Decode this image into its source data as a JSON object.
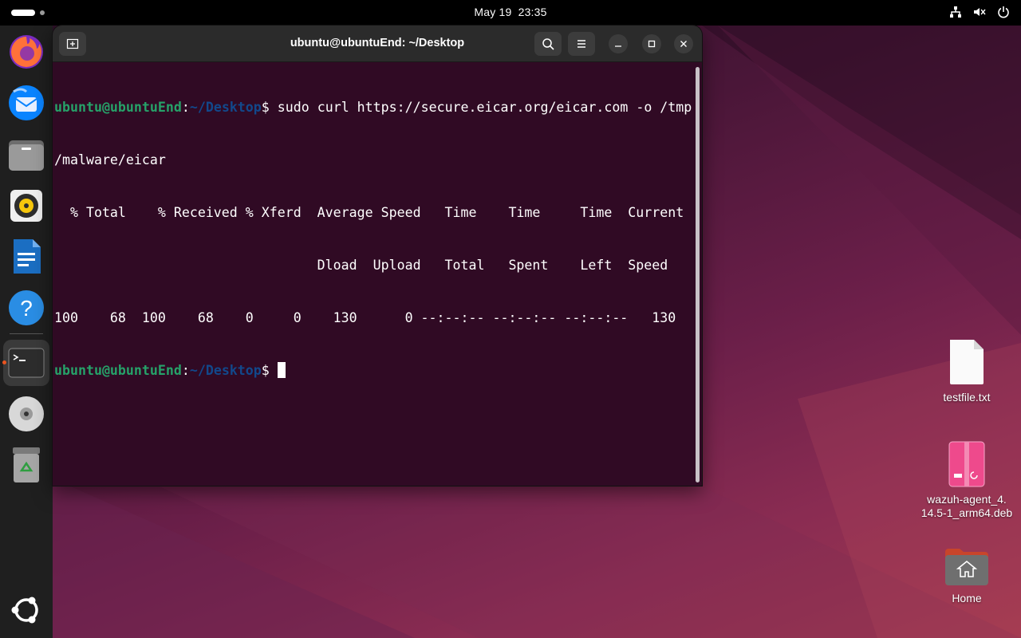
{
  "topbar": {
    "date": "May 19",
    "time": "23:35",
    "tray_icons": [
      "network-icon",
      "volume-muted-icon",
      "power-icon"
    ]
  },
  "dock": {
    "items": [
      "firefox",
      "thunderbird",
      "files",
      "rhythmbox",
      "libreoffice-writer",
      "help",
      "terminal",
      "optical-drive",
      "trash",
      "show-apps"
    ],
    "active": "terminal"
  },
  "terminal": {
    "title": "ubuntu@ubuntuEnd: ~/Desktop",
    "prompt_user": "ubuntu@ubuntuEnd",
    "prompt_sep": ":",
    "prompt_path": "~/Desktop",
    "prompt_sym": "$",
    "command": " sudo curl https://secure.eicar.org/eicar.com -o /tmp",
    "command_cont": "/malware/eicar",
    "output": [
      "  % Total    % Received % Xferd  Average Speed   Time    Time     Time  Current",
      "                                 Dload  Upload   Total   Spent    Left  Speed",
      "100    68  100    68    0     0    130      0 --:--:-- --:--:-- --:--:--   130"
    ]
  },
  "desktop": {
    "icons": [
      {
        "label": "testfile.txt"
      },
      {
        "label": "wazuh-agent_4.\n14.5-1_arm64.deb"
      },
      {
        "label": "Home"
      }
    ]
  },
  "colors": {
    "terminal_bg": "#300a24",
    "prompt_user": "#26a269",
    "prompt_path": "#12488b",
    "accent": "#e95420"
  }
}
